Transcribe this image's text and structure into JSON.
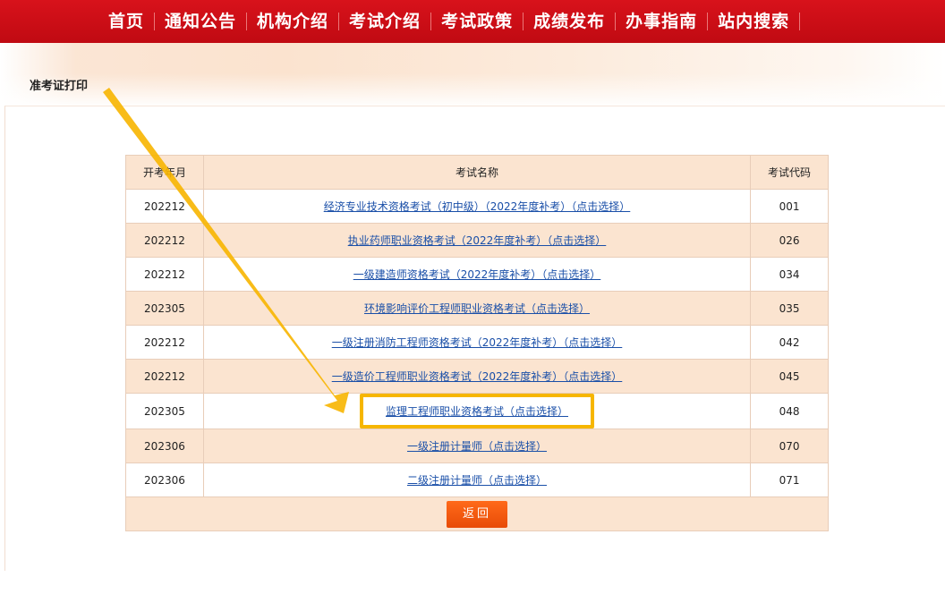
{
  "nav": {
    "items": [
      "首页",
      "通知公告",
      "机构介绍",
      "考试介绍",
      "考试政策",
      "成绩发布",
      "办事指南",
      "站内搜索"
    ]
  },
  "page": {
    "title": "准考证打印"
  },
  "table": {
    "headers": {
      "date": "开考年月",
      "name": "考试名称",
      "code": "考试代码"
    },
    "rows": [
      {
        "date": "202212",
        "name": "经济专业技术资格考试（初中级）（2022年度补考）（点击选择）",
        "code": "001"
      },
      {
        "date": "202212",
        "name": "执业药师职业资格考试（2022年度补考）（点击选择）",
        "code": "026"
      },
      {
        "date": "202212",
        "name": "一级建造师资格考试（2022年度补考）（点击选择）",
        "code": "034"
      },
      {
        "date": "202305",
        "name": "环境影响评价工程师职业资格考试（点击选择）",
        "code": "035"
      },
      {
        "date": "202212",
        "name": "一级注册消防工程师资格考试（2022年度补考）（点击选择）",
        "code": "042"
      },
      {
        "date": "202212",
        "name": "一级造价工程师职业资格考试（2022年度补考）（点击选择）",
        "code": "045"
      },
      {
        "date": "202305",
        "name": "监理工程师职业资格考试（点击选择）",
        "code": "048"
      },
      {
        "date": "202306",
        "name": "一级注册计量师（点击选择）",
        "code": "070"
      },
      {
        "date": "202306",
        "name": "二级注册计量师（点击选择）",
        "code": "071"
      }
    ],
    "back_label": "返回"
  },
  "colors": {
    "nav_bg": "#d8121b",
    "row_alt": "#fbe4d0",
    "link": "#1a4fa8",
    "highlight": "#f6b600",
    "button": "#f05a0e"
  }
}
